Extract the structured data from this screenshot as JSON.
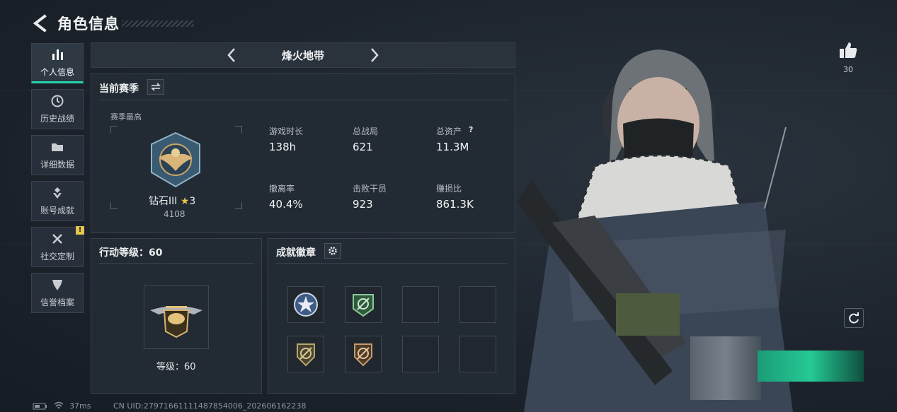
{
  "header": {
    "title": "角色信息"
  },
  "sidebar": {
    "items": [
      {
        "label": "个人信息",
        "icon": "bar-chart-icon"
      },
      {
        "label": "历史战绩",
        "icon": "history-icon"
      },
      {
        "label": "详细数据",
        "icon": "folder-icon"
      },
      {
        "label": "账号成就",
        "icon": "achievement-icon"
      },
      {
        "label": "社交定制",
        "icon": "tools-icon",
        "badge": "!"
      },
      {
        "label": "信誉档案",
        "icon": "shield-icon"
      }
    ]
  },
  "mode": {
    "name": "烽火地带"
  },
  "season": {
    "title": "当前赛季",
    "best_label": "赛季最高",
    "rank_name": "钻石III",
    "rank_stars": "3",
    "rank_points": "4108",
    "stats": [
      {
        "label": "游戏时长",
        "value": "138h"
      },
      {
        "label": "总战局",
        "value": "621"
      },
      {
        "label": "总资产",
        "value": "11.3M",
        "help": "?"
      },
      {
        "label": "撤离率",
        "value": "40.4%"
      },
      {
        "label": "击败干员",
        "value": "923"
      },
      {
        "label": "赚损比",
        "value": "861.3K"
      }
    ]
  },
  "action_level": {
    "title": "行动等级：60",
    "level_text": "等级：60"
  },
  "achievements": {
    "title": "成就徽章",
    "badges": [
      "star-badge",
      "green-crosshair-badge",
      "empty",
      "empty",
      "bronze-crosshair-badge",
      "bronze-crosshair-badge-2",
      "empty",
      "empty"
    ]
  },
  "like": {
    "count": "30"
  },
  "footer": {
    "ping": "37ms",
    "uid": "CN UID:27971661111487854006_202606162238"
  },
  "colors": {
    "accent": "#27d4b0",
    "panel": "#222a33",
    "badge_yellow": "#e6c64a"
  }
}
